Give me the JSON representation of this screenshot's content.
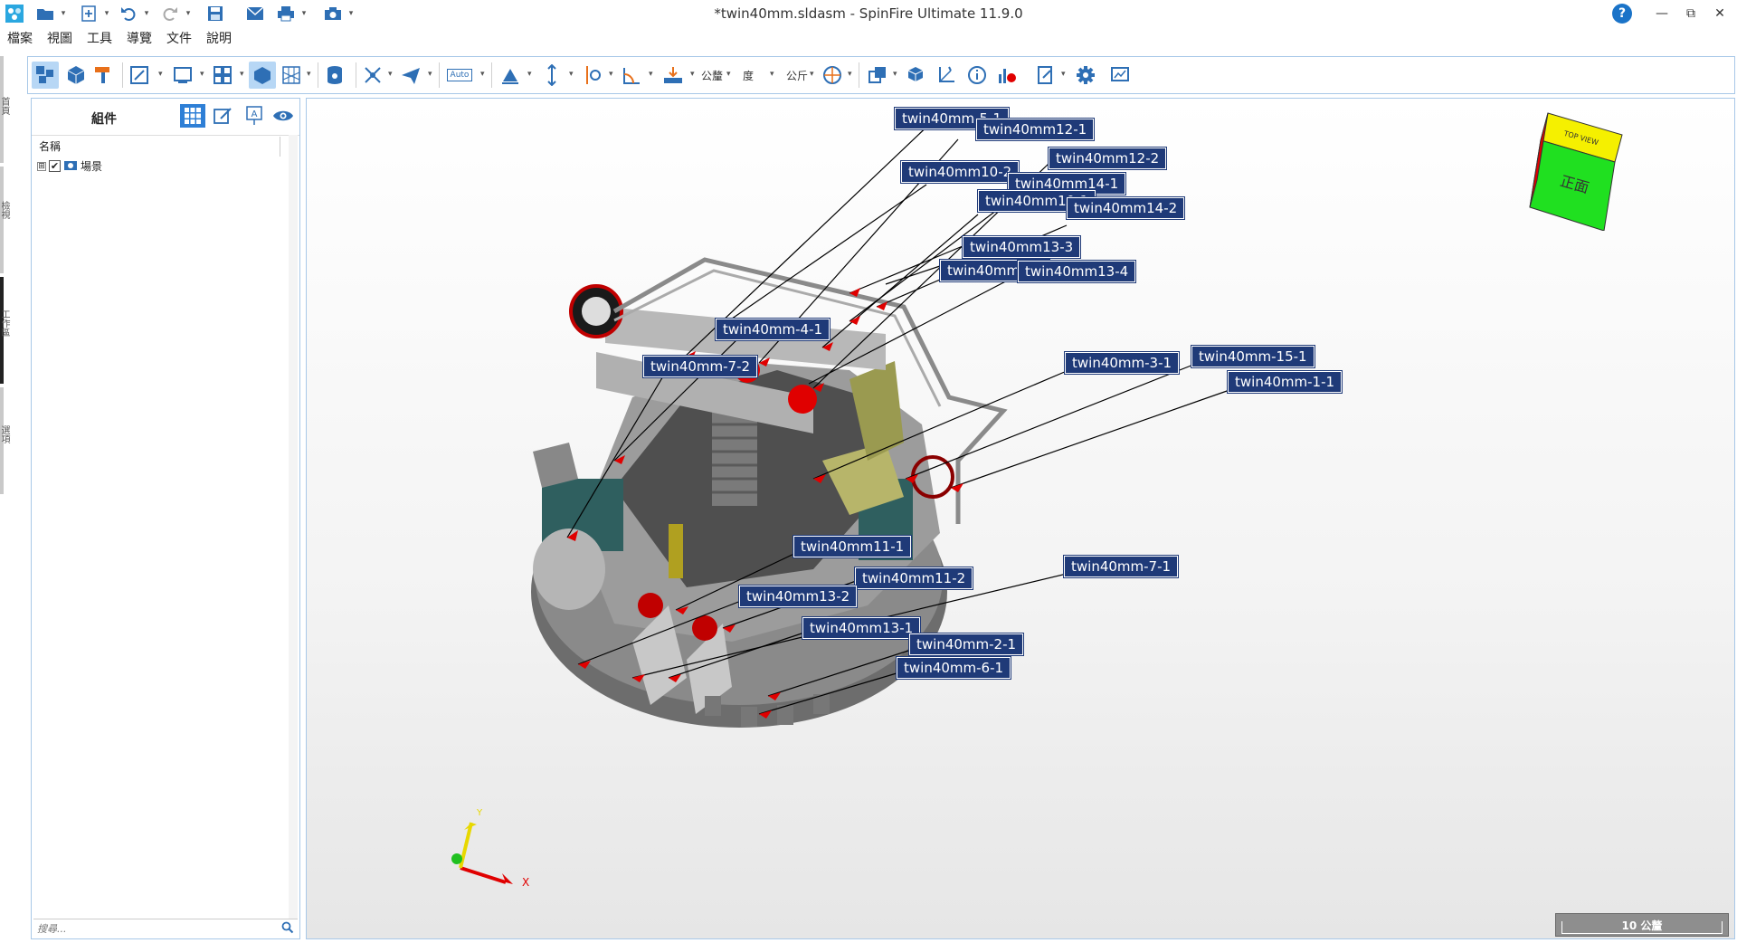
{
  "window": {
    "title": "*twin40mm.sldasm - SpinFire Ultimate 11.9.0",
    "controls": {
      "minimize": "—",
      "restore": "⧉",
      "close": "✕",
      "help": "?"
    }
  },
  "menu": {
    "items": [
      "檔案",
      "視圖",
      "工具",
      "導覽",
      "文件",
      "說明"
    ]
  },
  "toolbar": {
    "auto_label": "Auto",
    "tolerance_label": "公釐",
    "angle_label": "度",
    "mass_label": "公斤"
  },
  "side_tabs": [
    "首頁",
    "檢視",
    "工作區",
    "選項"
  ],
  "left_panel": {
    "title": "組件",
    "column_header": "名稱",
    "tree": [
      {
        "label": "場景",
        "expander": "⊞",
        "checked": true
      }
    ],
    "search_placeholder": "搜尋..."
  },
  "viewport": {
    "view_cube_front": "正面",
    "view_cube_top": "TOP VIEW",
    "triad_x": "X",
    "triad_y": "Y",
    "scale_bar": "10 公釐",
    "callouts": [
      {
        "id": "5-1",
        "label": "twin40mm-5-1"
      },
      {
        "id": "12-1",
        "label": "twin40mm12-1"
      },
      {
        "id": "12-2",
        "label": "twin40mm12-2"
      },
      {
        "id": "10-2",
        "label": "twin40mm10-2"
      },
      {
        "id": "14-1",
        "label": "twin40mm14-1"
      },
      {
        "id": "10-1",
        "label": "twin40mm10-1"
      },
      {
        "id": "14-2",
        "label": "twin40mm14-2"
      },
      {
        "id": "13-3",
        "label": "twin40mm13-3"
      },
      {
        "id": "8-1",
        "label": "twin40mm8-1"
      },
      {
        "id": "13-4",
        "label": "twin40mm13-4"
      },
      {
        "id": "4-1",
        "label": "twin40mm-4-1"
      },
      {
        "id": "7-2",
        "label": "twin40mm-7-2"
      },
      {
        "id": "3-1",
        "label": "twin40mm-3-1"
      },
      {
        "id": "15-1",
        "label": "twin40mm-15-1"
      },
      {
        "id": "1-1",
        "label": "twin40mm-1-1"
      },
      {
        "id": "11-1",
        "label": "twin40mm11-1"
      },
      {
        "id": "11-2",
        "label": "twin40mm11-2"
      },
      {
        "id": "7-1",
        "label": "twin40mm-7-1"
      },
      {
        "id": "13-2",
        "label": "twin40mm13-2"
      },
      {
        "id": "13-1",
        "label": "twin40mm13-1"
      },
      {
        "id": "2-1",
        "label": "twin40mm-2-1"
      },
      {
        "id": "6-1",
        "label": "twin40mm-6-1"
      }
    ]
  },
  "colors": {
    "accent": "#2e7fd6",
    "callout_bg": "#1f3a78",
    "panel_border": "#a8c8e8",
    "leader_arrow": "#e00000"
  }
}
